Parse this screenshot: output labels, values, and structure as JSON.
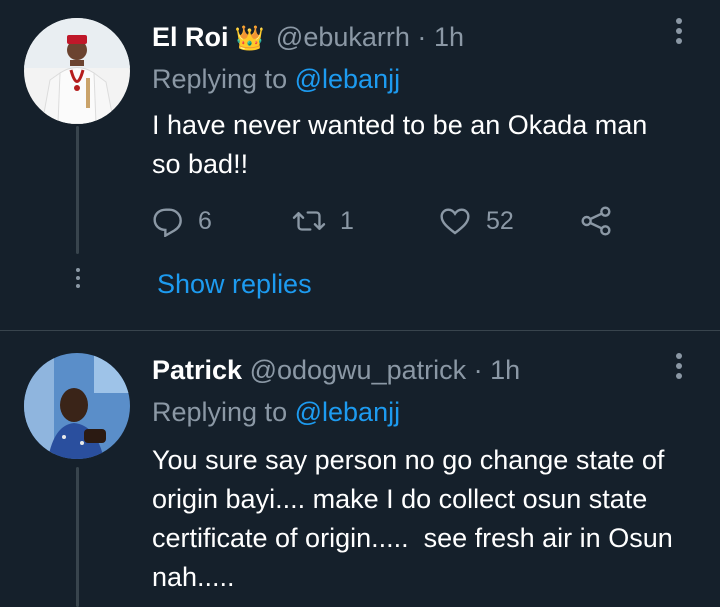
{
  "tweets": [
    {
      "display_name": "El Roi",
      "badge_emoji": "👑",
      "handle": "@ebukarrh",
      "separator": "·",
      "time": "1h",
      "replying_prefix": "Replying to",
      "replying_to": "@lebanjj",
      "text": "I have never wanted to be an Okada man so bad!!",
      "replies_count": "6",
      "retweets_count": "1",
      "likes_count": "52",
      "show_replies": "Show replies"
    },
    {
      "display_name": "Patrick",
      "handle": "@odogwu_patrick",
      "separator": "·",
      "time": "1h",
      "replying_prefix": "Replying to",
      "replying_to": "@lebanjj",
      "text": "You sure say person no go change state of origin bayi.... make I do collect osun state certificate of origin.....  see fresh air in Osun nah....."
    }
  ],
  "colors": {
    "background": "#15202b",
    "accent": "#1d9bf0",
    "secondary_text": "#8b98a5",
    "divider": "#38444d"
  },
  "icons": [
    "reply-icon",
    "retweet-icon",
    "like-icon",
    "share-icon",
    "more-options-icon"
  ]
}
